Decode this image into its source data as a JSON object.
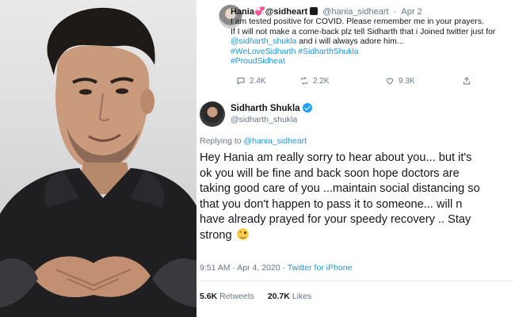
{
  "reply_tweet": {
    "display_name": "Hania💞@sidheart",
    "handle": "@hania_sidheart",
    "date": "Apr 2",
    "lines": [
      "I am tested positive for COVID. Please remember me in your prayers.",
      "If I will not make a come-back plz tell Sidharth that i Joined twitter just for"
    ],
    "mention_line": {
      "mention": "@sidharth_shukla",
      "rest": " and i will always adore him..."
    },
    "hashtags_line1": "#WeLoveSidharth #SidharthShukla",
    "hashtags_line2": "#ProudSidheat",
    "actions": {
      "replies": "2.4K",
      "retweets": "2.2K",
      "likes": "9.3K"
    }
  },
  "main_tweet": {
    "name": "Sidharth Shukla",
    "handle": "@sidharth_shukla",
    "replying_prefix": "Replying to",
    "replying_to": "@hania_sidheart",
    "text_lines": [
      "Hey Hania am really sorry to hear about you... but it's",
      "ok you will be fine and back soon hope doctors are",
      "taking good care of you ...maintain social distancing so",
      "that you don't happen to pass it to someone... will n",
      "have already prayed for your speedy recovery .. Stay",
      "strong"
    ],
    "timestamp": "9:51 AM · Apr 4, 2020 · ",
    "source": "Twitter for iPhone",
    "retweets_count": "5.6K",
    "retweets_label": "Retweets",
    "likes_count": "20.7K",
    "likes_label": "Likes"
  },
  "colors": {
    "link": "#1b95e0",
    "muted": "#657786",
    "text": "#14171a",
    "verified": "#1da1f2"
  }
}
